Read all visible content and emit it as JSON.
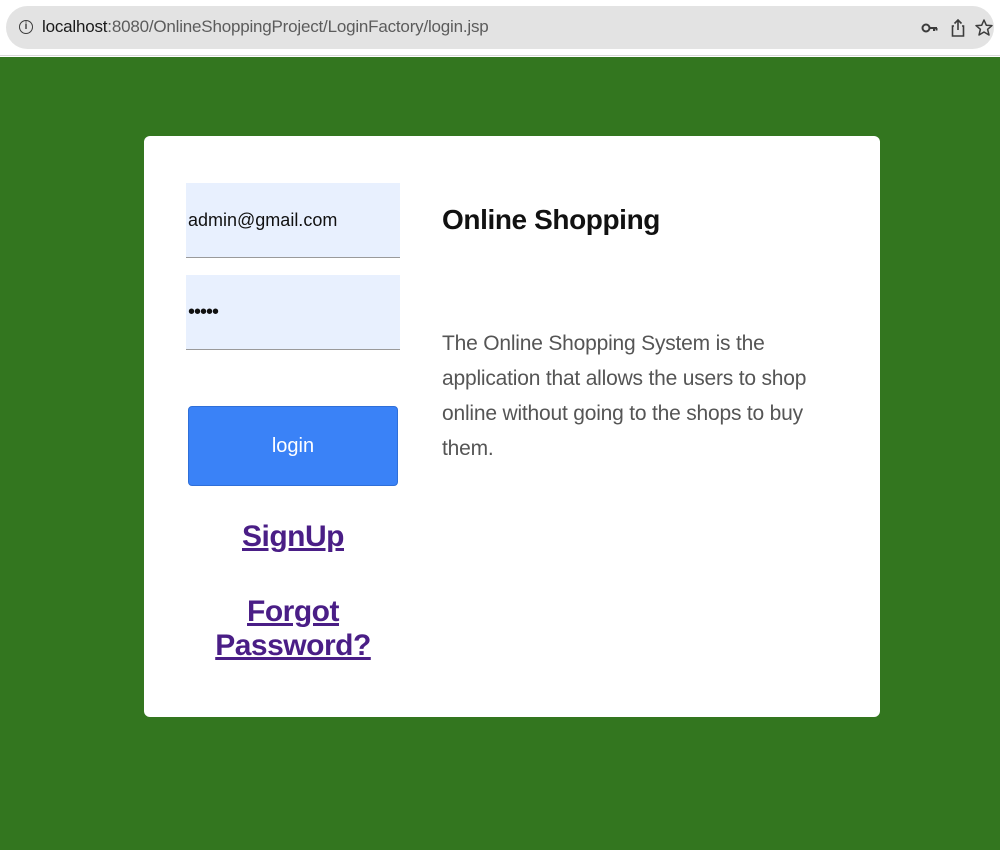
{
  "browser": {
    "url_host": "localhost",
    "url_rest": ":8080/OnlineShoppingProject/LoginFactory/login.jsp",
    "icons": [
      "info-icon",
      "key-icon",
      "share-icon",
      "star-icon"
    ]
  },
  "colors": {
    "page_background": "#33761f",
    "card_background": "#ffffff",
    "field_background": "#e8f0fe",
    "button_background": "#3a82f7",
    "link_color": "#4a1e86"
  },
  "login_form": {
    "email_value": "admin@gmail.com",
    "password_value": "•••••",
    "login_label": "login",
    "signup_label": "SignUp",
    "forgot_label": "Forgot Password?"
  },
  "info": {
    "title": "Online Shopping",
    "description": "The Online Shopping System is the application that allows the users to shop online without going to the shops to buy them."
  }
}
